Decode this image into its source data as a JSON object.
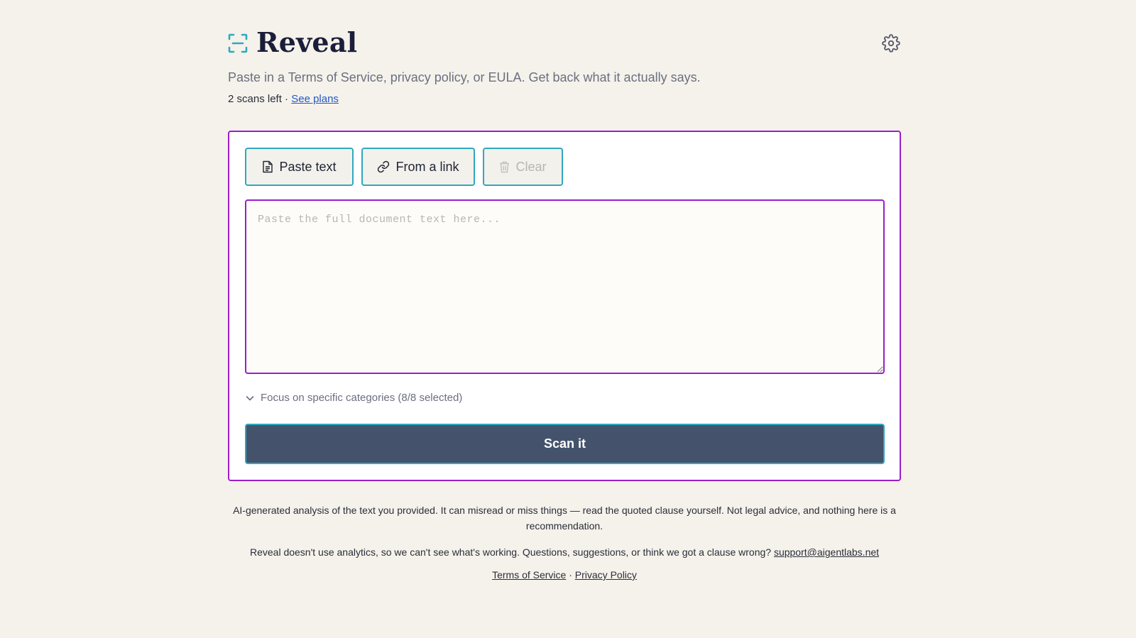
{
  "app": {
    "title": "Reveal",
    "subtitle": "Paste in a Terms of Service, privacy policy, or EULA. Get back what it actually says.",
    "scans_left": "2 scans left",
    "separator": "·",
    "see_plans": "See plans"
  },
  "toolbar": {
    "paste_label": "Paste text",
    "link_label": "From a link",
    "clear_label": "Clear"
  },
  "editor": {
    "placeholder": "Paste the full document text here...",
    "value": ""
  },
  "focus": {
    "label": "Focus on specific categories (8/8 selected)"
  },
  "scan": {
    "label": "Scan it"
  },
  "footer": {
    "disclaimer": "AI-generated analysis of the text you provided. It can misread or miss things — read the quoted clause yourself. Not legal advice, and nothing here is a recommendation.",
    "contact_text": "Reveal doesn't use analytics, so we can't see what's working. Questions, suggestions, or think we got a clause wrong?",
    "contact_email": "support@aigentlabs.net",
    "terms": "Terms of Service",
    "separator": "·",
    "privacy": "Privacy Policy"
  },
  "colors": {
    "accent_purple": "#9b1ec8",
    "accent_teal": "#2fa8bf",
    "scan_button": "#44536b",
    "background": "#f5f2eb"
  },
  "icons": {
    "logo": "scan-frame-icon",
    "settings": "gear-icon",
    "paste": "document-icon",
    "link": "link-icon",
    "clear": "trash-icon",
    "focus": "chevron-down-icon"
  }
}
